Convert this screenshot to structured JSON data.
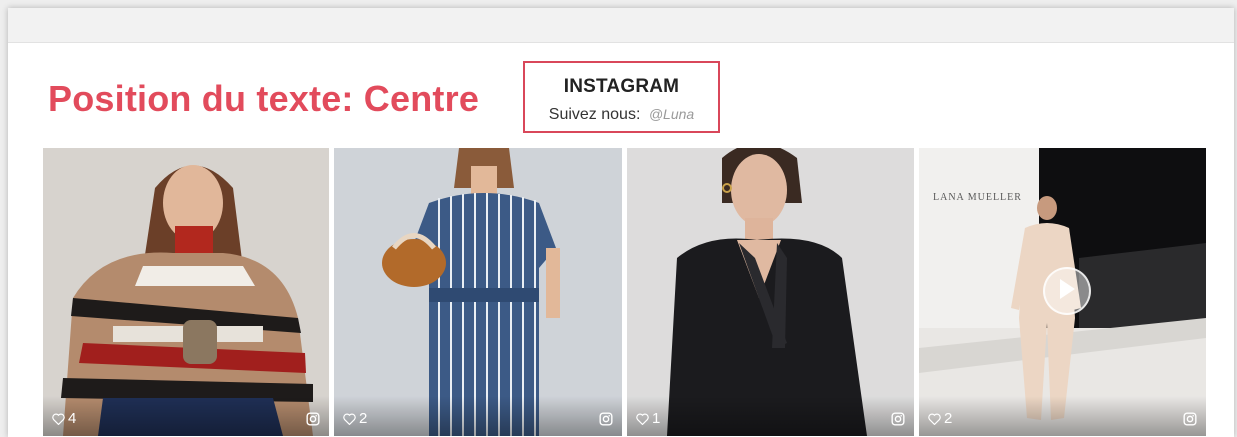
{
  "heading": "Position du texte: Centre",
  "instagram": {
    "title": "INSTAGRAM",
    "follow_label": "Suivez nous:",
    "handle": "@Luna"
  },
  "posts": [
    {
      "likes": "4",
      "type": "photo"
    },
    {
      "likes": "2",
      "type": "photo"
    },
    {
      "likes": "1",
      "type": "photo"
    },
    {
      "likes": "2",
      "type": "video",
      "brand": "LANA MUELLER"
    }
  ],
  "colors": {
    "accent": "#e24b5c",
    "box_border": "#d9475a"
  }
}
